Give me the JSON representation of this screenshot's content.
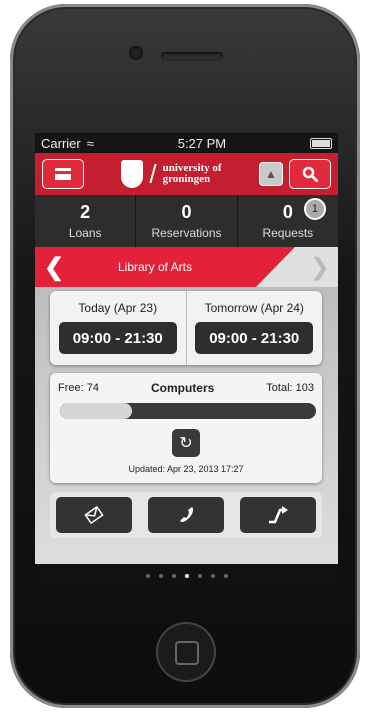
{
  "status": {
    "carrier": "Carrier",
    "time": "5:27 PM"
  },
  "header": {
    "logo_line1": "university of",
    "logo_line2": "groningen",
    "accent_color": "#c41e30"
  },
  "counts": [
    {
      "value": "2",
      "label": "Loans"
    },
    {
      "value": "0",
      "label": "Reservations"
    },
    {
      "value": "0",
      "label": "Requests",
      "badge": "1"
    }
  ],
  "library": {
    "name": "Library of Arts"
  },
  "hours": {
    "today_label": "Today (Apr 23)",
    "today_value": "09:00 - 21:30",
    "tomorrow_label": "Tomorrow (Apr 24)",
    "tomorrow_value": "09:00 - 21:30"
  },
  "computers": {
    "free": "Free: 74",
    "title": "Computers",
    "total": "Total: 103",
    "free_fraction": 0.28,
    "updated": "Updated: Apr 23, 2013 17:27"
  },
  "actions": [
    {
      "icon": "email-icon"
    },
    {
      "icon": "phone-icon"
    },
    {
      "icon": "directions-icon"
    }
  ],
  "pager": {
    "count": 7,
    "active": 3
  }
}
